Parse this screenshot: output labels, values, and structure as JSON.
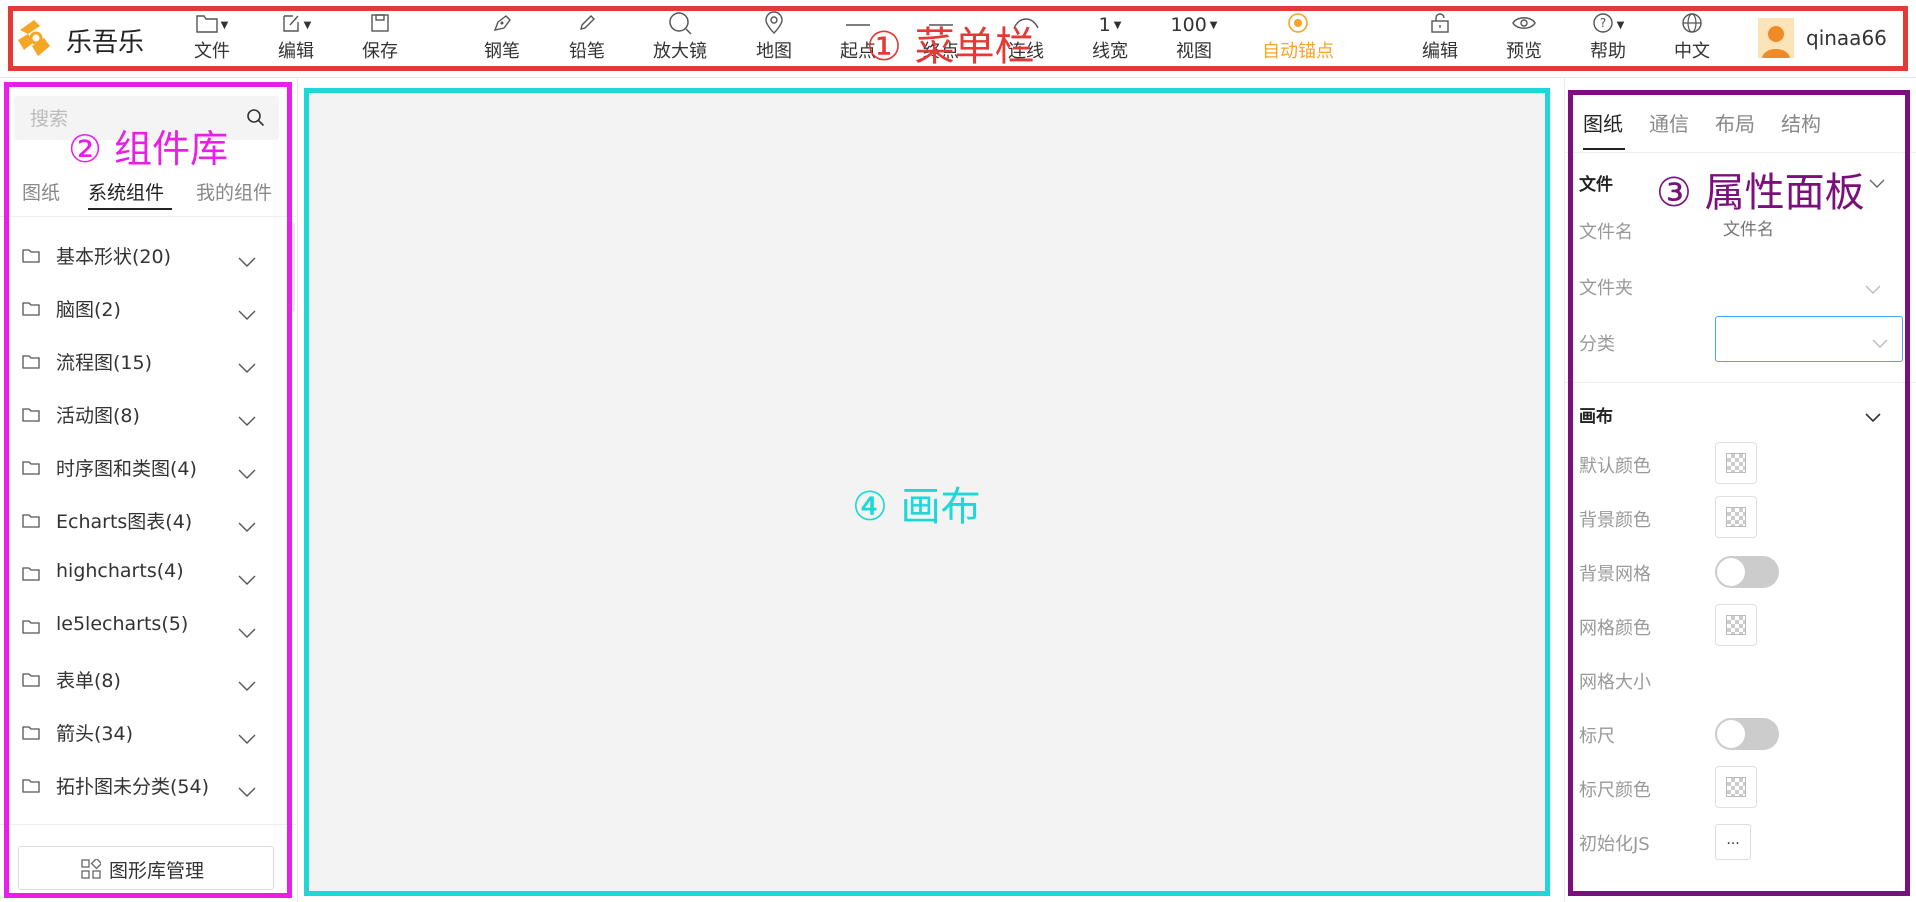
{
  "app": {
    "title": "乐吾乐",
    "logo": "le5le-logo"
  },
  "toolbar": {
    "items": [
      {
        "label": "文件",
        "icon": "folder-icon",
        "dropdown": true
      },
      {
        "label": "编辑",
        "icon": "edit-icon",
        "dropdown": true
      },
      {
        "label": "保存",
        "icon": "save-icon"
      },
      {
        "label": "钢笔",
        "icon": "pen-icon"
      },
      {
        "label": "铅笔",
        "icon": "pencil-icon"
      },
      {
        "label": "放大镜",
        "icon": "magnifier-icon"
      },
      {
        "label": "地图",
        "icon": "map-pin-icon"
      },
      {
        "label": "起点",
        "icon": "line-start-icon"
      },
      {
        "label": "终点",
        "icon": "line-end-icon"
      },
      {
        "label": "连线",
        "icon": "connector-icon"
      },
      {
        "label": "线宽",
        "value": "1",
        "dropdown": true
      },
      {
        "label": "视图",
        "value": "100",
        "dropdown": true
      },
      {
        "label": "自动锚点",
        "icon": "anchor-icon",
        "active": true
      },
      {
        "label": "编辑",
        "icon": "unlock-icon"
      },
      {
        "label": "预览",
        "icon": "eye-icon"
      },
      {
        "label": "帮助",
        "icon": "help-icon",
        "dropdown": true
      },
      {
        "label": "中文",
        "icon": "globe-icon"
      }
    ],
    "user": {
      "name": "qinaa66",
      "avatar": "user-avatar"
    }
  },
  "library": {
    "search_placeholder": "搜索",
    "tabs": [
      "图纸",
      "系统组件",
      "我的组件"
    ],
    "active_tab": "系统组件",
    "categories": [
      "基本形状(20)",
      "脑图(2)",
      "流程图(15)",
      "活动图(8)",
      "时序图和类图(4)",
      "Echarts图表(4)",
      "highcharts(4)",
      "le5lecharts(5)",
      "表单(8)",
      "箭头(34)",
      "拓扑图未分类(54)"
    ],
    "manage_button": "图形库管理"
  },
  "props": {
    "tabs": [
      "图纸",
      "通信",
      "布局",
      "结构"
    ],
    "active_tab": "图纸",
    "file_section": "文件",
    "filename_label": "文件名",
    "filename_placeholder": "文件名",
    "folder_label": "文件夹",
    "category_label": "分类",
    "canvas_section": "画布",
    "fields": {
      "default_color": "默认颜色",
      "bg_color": "背景颜色",
      "bg_grid": "背景网格",
      "grid_color": "网格颜色",
      "grid_size": "网格大小",
      "ruler": "标尺",
      "ruler_color": "标尺颜色",
      "init_js": "初始化JS"
    },
    "init_js_button": "...",
    "toggles": {
      "bg_grid": false,
      "ruler": false
    }
  },
  "annotations": {
    "menubar": "① 菜单栏",
    "library": "② 组件库",
    "props": "③ 属性面板",
    "canvas": "④ 画布"
  },
  "colors": {
    "accent": "#f5a623",
    "menubar_box": "#e53935",
    "library_box": "#e91ee9",
    "props_box": "#7b0f7b",
    "canvas_box": "#1ed8d8"
  }
}
